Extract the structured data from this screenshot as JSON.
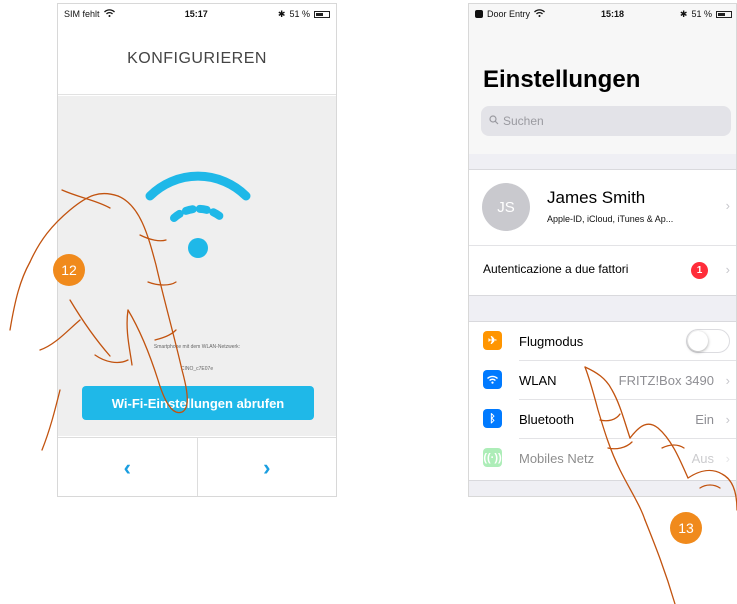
{
  "left_phone": {
    "status": {
      "carrier": "SIM fehlt",
      "time": "15:17",
      "battery": "51 %"
    },
    "title": "KONFIGURIEREN",
    "instruction_text": "Smartphone mit dem WLAN-Netzwerk:",
    "network_text": "CINO_c7E07e",
    "wifi_button": "Wi-Fi-Einstellungen abrufen",
    "nav_prev": "‹",
    "nav_next": "›",
    "colors": {
      "accent": "#1fb8e8",
      "icon": "#1a9ee0"
    }
  },
  "right_phone": {
    "status": {
      "app_back": "Door Entry",
      "time": "15:18",
      "battery": "51 %"
    },
    "title": "Einstellungen",
    "search_placeholder": "Suchen",
    "profile": {
      "initials": "JS",
      "name": "James Smith",
      "subtitle": "Apple-ID, iCloud, iTunes & Ap..."
    },
    "two_factor": {
      "label": "Autenticazione a due fattori",
      "badge": "1"
    },
    "settings": [
      {
        "label": "Flugmodus",
        "value": "",
        "icon": "airplane-icon",
        "color": "#ff9500"
      },
      {
        "label": "WLAN",
        "value": "FRITZ!Box 3490",
        "icon": "wifi-icon",
        "color": "#007aff"
      },
      {
        "label": "Bluetooth",
        "value": "Ein",
        "icon": "bluetooth-icon",
        "color": "#007aff"
      },
      {
        "label": "Mobiles Netz",
        "value": "Aus",
        "icon": "antenna-icon",
        "color": "#4cd964"
      }
    ]
  },
  "steps": {
    "first": "12",
    "second": "13"
  },
  "colors": {
    "step_badge": "#f08a1c",
    "hand_outline": "#c2530f"
  }
}
